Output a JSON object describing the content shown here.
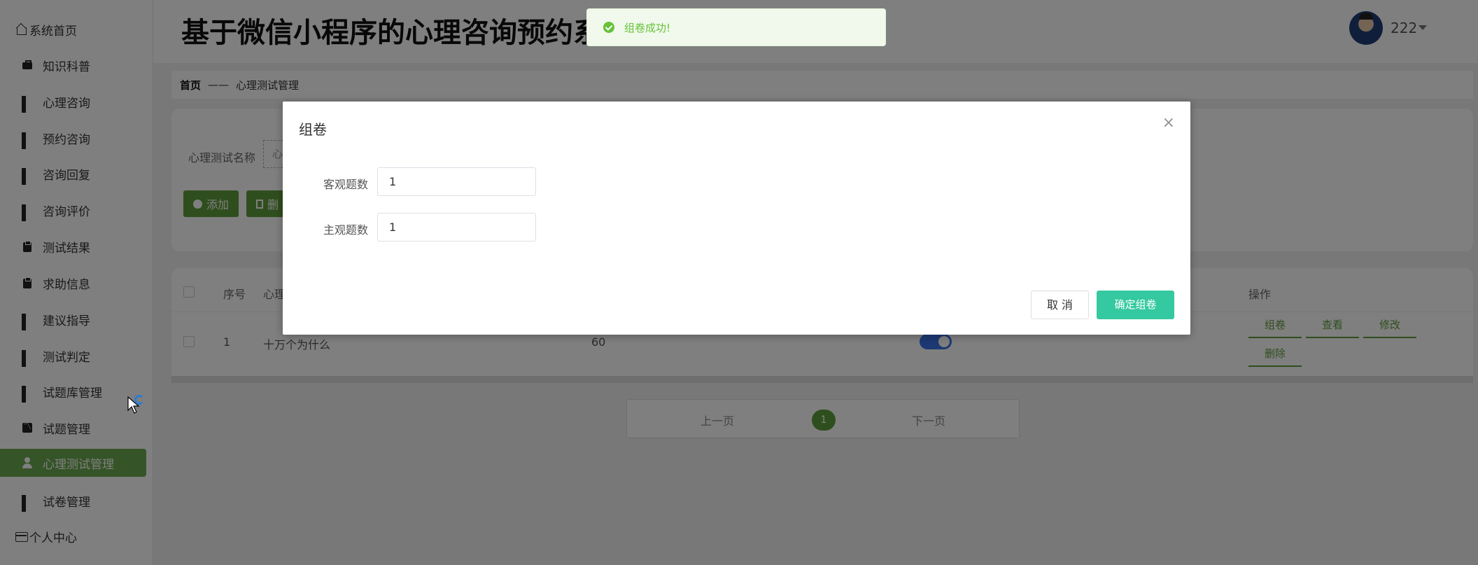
{
  "app": {
    "title": "基于微信小程序的心理咨询预约系统"
  },
  "user": {
    "name": "222"
  },
  "sidebar": {
    "items": [
      {
        "label": "系统首页",
        "icon": "home-icon"
      },
      {
        "label": "知识科普",
        "icon": "briefcase-icon"
      },
      {
        "label": "心理咨询",
        "icon": "grid-icon"
      },
      {
        "label": "预约咨询",
        "icon": "grid-icon"
      },
      {
        "label": "咨询回复",
        "icon": "grid-icon"
      },
      {
        "label": "咨询评价",
        "icon": "grid-icon"
      },
      {
        "label": "测试结果",
        "icon": "clipboard-icon"
      },
      {
        "label": "求助信息",
        "icon": "clipboard-icon"
      },
      {
        "label": "建议指导",
        "icon": "grid-icon"
      },
      {
        "label": "测试判定",
        "icon": "grid-icon"
      },
      {
        "label": "试题库管理",
        "icon": "grid-icon"
      },
      {
        "label": "试题管理",
        "icon": "chart-icon"
      },
      {
        "label": "心理测试管理",
        "icon": "user-icon",
        "active": true
      },
      {
        "label": "试卷管理",
        "icon": "grid-icon"
      },
      {
        "label": "个人中心",
        "icon": "wallet-icon"
      }
    ]
  },
  "breadcrumb": {
    "home": "首页",
    "separator": "——",
    "current": "心理测试管理"
  },
  "search": {
    "label": "心理测试名称",
    "placeholder": "心",
    "add_label": "添加",
    "delete_label": "删"
  },
  "table": {
    "headers": {
      "index": "序号",
      "name": "心理",
      "ops": "操作"
    },
    "rows": [
      {
        "index": "1",
        "name": "十万个为什么",
        "score": "60",
        "enabled": true
      }
    ],
    "actions": {
      "compose": "组卷",
      "view": "查看",
      "edit": "修改",
      "delete": "删除"
    }
  },
  "pager": {
    "prev": "上一页",
    "current": "1",
    "next": "下一页"
  },
  "dialog": {
    "title": "组卷",
    "close": "×",
    "fields": [
      {
        "label": "客观题数",
        "value": "1"
      },
      {
        "label": "主观题数",
        "value": "1"
      }
    ],
    "cancel_label": "取 消",
    "confirm_label": "确定组卷"
  },
  "toast": {
    "message": "组卷成功!"
  },
  "colors": {
    "accent": "#5f9d3b",
    "confirm": "#34c9a0",
    "success": "#67c23a",
    "toggle": "#3b73e8"
  }
}
